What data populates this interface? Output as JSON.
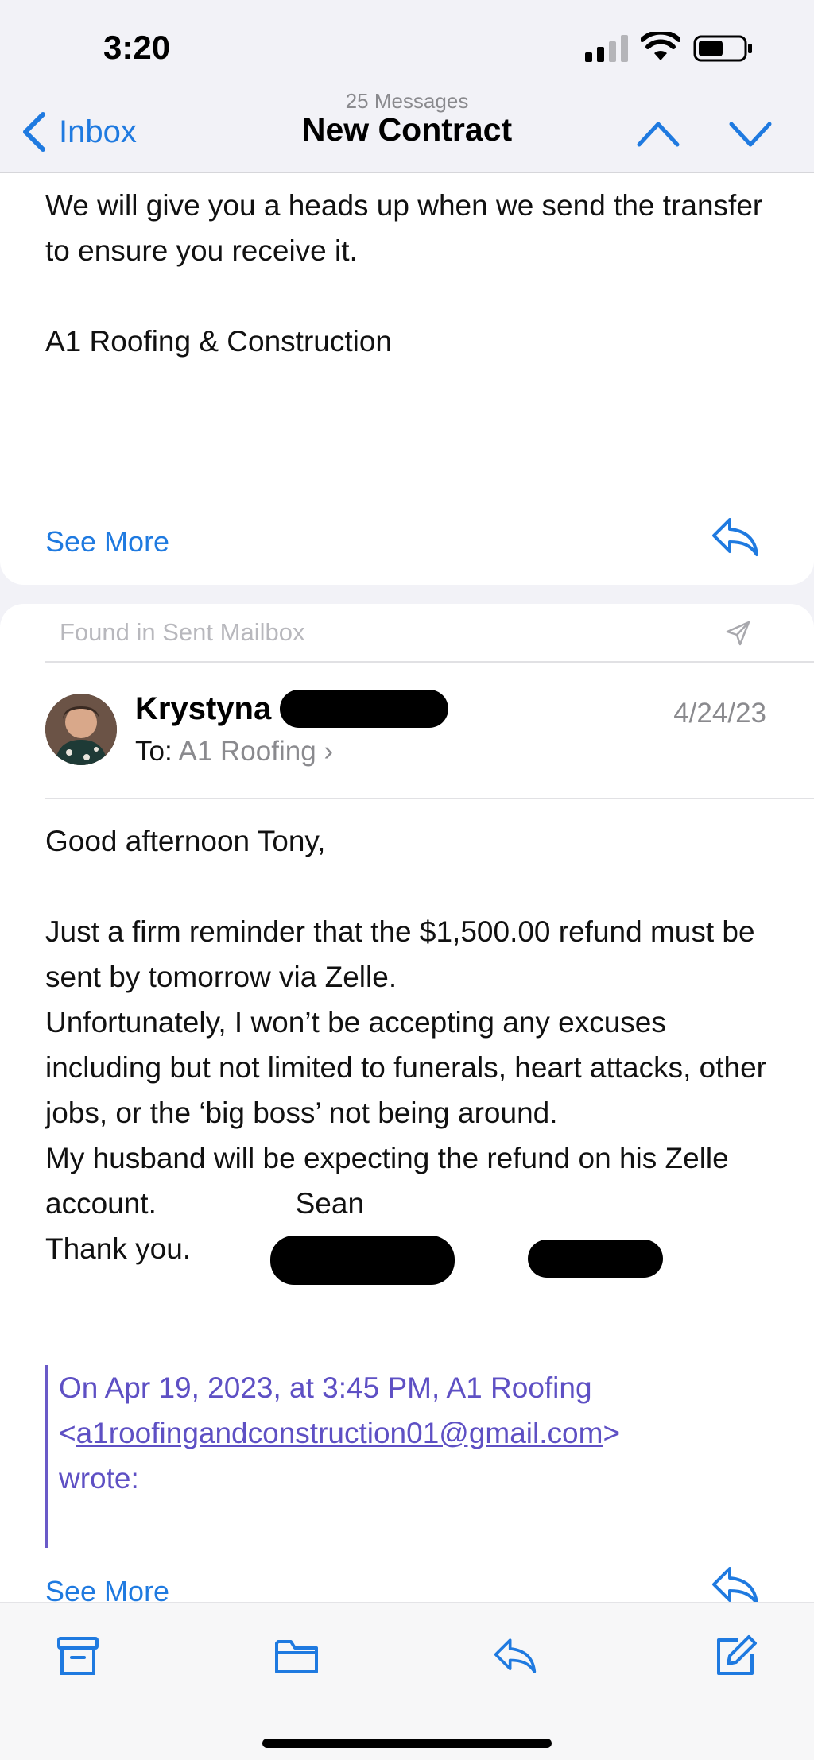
{
  "status_bar": {
    "time": "3:20",
    "icons": [
      "cellular-signal-icon",
      "wifi-icon",
      "battery-icon"
    ]
  },
  "nav": {
    "back_label": "Inbox",
    "message_count": "25 Messages",
    "title": "New Contract",
    "icons": [
      "chevron-left-icon",
      "chevron-up-icon",
      "chevron-down-icon"
    ]
  },
  "message1": {
    "body": "We will give you a heads up when we send the transfer to ensure you receive it.\n\nA1 Roofing & Construction",
    "see_more": "See More"
  },
  "message2": {
    "found_in": "Found in Sent Mailbox",
    "sender": "Krystyna",
    "to_prefix": "To:",
    "to_name": "A1 Roofing",
    "date": "4/24/23",
    "body": "Good afternoon Tony,\n\nJust a firm reminder that the $1,500.00 refund must be sent by tomorrow via Zelle.\nUnfortunately, I won’t be accepting any excuses including but not limited to funerals, heart attacks, other jobs, or the ‘big boss’ not being around.\nMy husband will be expecting the refund on his Zelle account.                 Sean\nThank you.",
    "quote_prefix": "On Apr 19, 2023, at 3:45 PM, A1 Roofing",
    "quote_email": "a1roofingandconstruction01@gmail.com",
    "quote_suffix": "wrote:",
    "see_more": "See More"
  },
  "colors": {
    "accent": "#1f7ae0",
    "quote": "#5e50c4",
    "secondary_text": "#8a8a8e"
  },
  "toolbar": {
    "icons": [
      "archive-icon",
      "folder-icon",
      "reply-icon",
      "compose-icon"
    ]
  }
}
